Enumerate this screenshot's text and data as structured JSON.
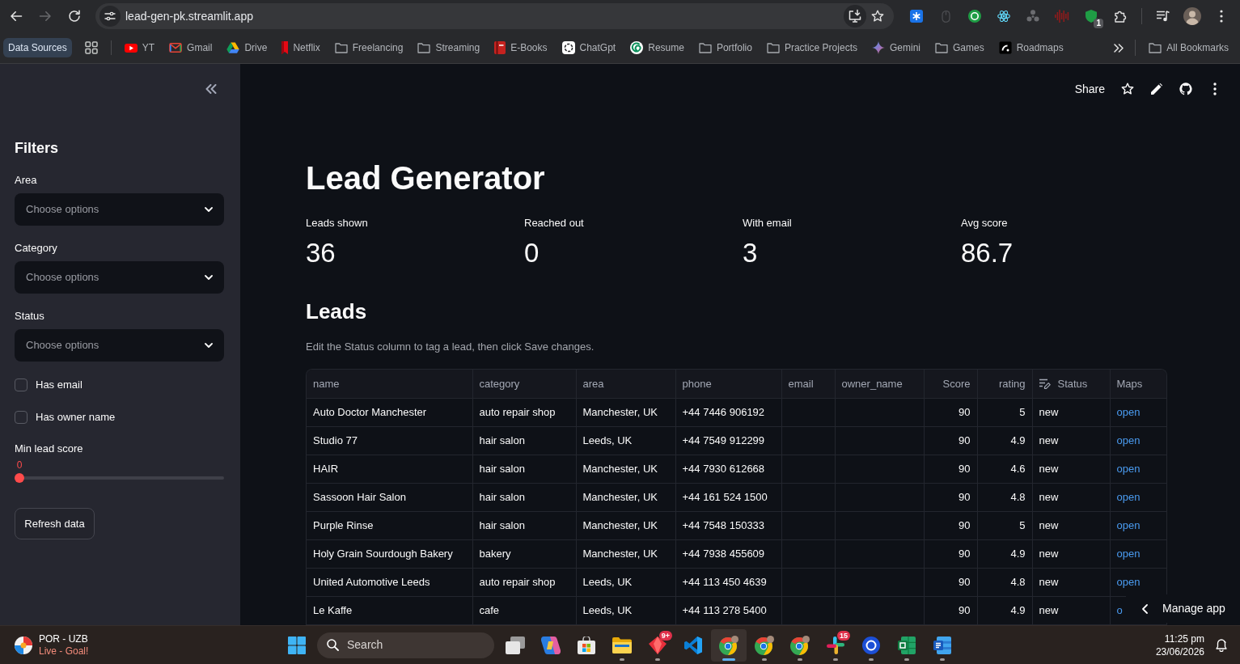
{
  "browser": {
    "nav_buttons": [
      {
        "kind": "back",
        "disabled": false
      },
      {
        "kind": "forward",
        "disabled": true
      },
      {
        "kind": "reload",
        "disabled": false
      }
    ],
    "url": "lead-gen-pk.streamlit.app",
    "extensions": [
      {
        "kind": "tile"
      },
      {
        "kind": "mouse"
      },
      {
        "kind": "disc"
      },
      {
        "kind": "atom"
      },
      {
        "kind": "trefoil"
      },
      {
        "kind": "waveform"
      },
      {
        "kind": "shield",
        "badge": "1"
      },
      {
        "kind": "puzzle"
      }
    ],
    "bookmarks": [
      {
        "kind": "group",
        "label": "Data Sources"
      },
      {
        "kind": "apps"
      },
      {
        "kind": "play",
        "label": "YT"
      },
      {
        "kind": "mail",
        "label": "Gmail"
      },
      {
        "kind": "triangle",
        "label": "Drive"
      },
      {
        "kind": "ribbon",
        "label": "Netflix"
      },
      {
        "kind": "folder",
        "label": "Freelancing"
      },
      {
        "kind": "folder",
        "label": "Streaming"
      },
      {
        "kind": "book",
        "label": "E-Books"
      },
      {
        "kind": "ring",
        "label": "ChatGpt"
      },
      {
        "kind": "swirl",
        "label": "Resume"
      },
      {
        "kind": "folder",
        "label": "Portfolio"
      },
      {
        "kind": "folder",
        "label": "Practice Projects"
      },
      {
        "kind": "sparkle",
        "label": "Gemini"
      },
      {
        "kind": "folder",
        "label": "Games"
      },
      {
        "kind": "tile",
        "label": "Roadmaps"
      }
    ],
    "all_bookmarks": "All Bookmarks"
  },
  "sidebar": {
    "title": "Filters",
    "selects": [
      {
        "label": "Area",
        "placeholder": "Choose options"
      },
      {
        "label": "Category",
        "placeholder": "Choose options"
      },
      {
        "label": "Status",
        "placeholder": "Choose options"
      }
    ],
    "checkboxes": [
      {
        "label": "Has email",
        "checked": false
      },
      {
        "label": "Has owner name",
        "checked": false
      }
    ],
    "slider": {
      "label": "Min lead score",
      "reading": "0",
      "level": 0
    },
    "button": "Refresh data"
  },
  "app_header": {
    "share": "Share"
  },
  "main": {
    "title": "Lead Generator",
    "metrics": [
      {
        "label": "Leads shown",
        "value": "36"
      },
      {
        "label": "Reached out",
        "value": "0"
      },
      {
        "label": "With email",
        "value": "3"
      },
      {
        "label": "Avg score",
        "value": "86.7"
      }
    ],
    "section": "Leads",
    "caption": "Edit the Status column to tag a lead, then click Save changes.",
    "table": {
      "columns": [
        {
          "label": "name",
          "kind": "text"
        },
        {
          "label": "category",
          "kind": "text"
        },
        {
          "label": "area",
          "kind": "text"
        },
        {
          "label": "phone",
          "kind": "text"
        },
        {
          "label": "email",
          "kind": "text"
        },
        {
          "label": "owner_name",
          "kind": "text"
        },
        {
          "label": "Score",
          "kind": "number"
        },
        {
          "label": "rating",
          "kind": "number"
        },
        {
          "label": "Status",
          "kind": "editable"
        },
        {
          "label": "Maps",
          "kind": "link"
        }
      ],
      "rows": [
        {
          "cells": [
            "Auto Doctor Manchester",
            "auto repair shop",
            "Manchester, UK",
            "+44 7446 906192"
          ],
          "end_cells": [
            "90",
            "5",
            "new",
            "open"
          ]
        },
        {
          "cells": [
            "Studio 77",
            "hair salon",
            "Leeds, UK",
            "+44 7549 912299"
          ],
          "end_cells": [
            "90",
            "4.9",
            "new",
            "open"
          ]
        },
        {
          "cells": [
            "HAIR",
            "hair salon",
            "Manchester, UK",
            "+44 7930 612668"
          ],
          "end_cells": [
            "90",
            "4.6",
            "new",
            "open"
          ]
        },
        {
          "cells": [
            "Sassoon Hair Salon",
            "hair salon",
            "Manchester, UK",
            "+44 161 524 1500"
          ],
          "end_cells": [
            "90",
            "4.8",
            "new",
            "open"
          ]
        },
        {
          "cells": [
            "Purple Rinse",
            "hair salon",
            "Manchester, UK",
            "+44 7548 150333"
          ],
          "end_cells": [
            "90",
            "5",
            "new",
            "open"
          ]
        },
        {
          "cells": [
            "Holy Grain Sourdough Bakery",
            "bakery",
            "Manchester, UK",
            "+44 7938 455609"
          ],
          "end_cells": [
            "90",
            "4.9",
            "new",
            "open"
          ]
        },
        {
          "cells": [
            "United Automotive Leeds",
            "auto repair shop",
            "Leeds, UK",
            "+44 113 450 4639"
          ],
          "end_cells": [
            "90",
            "4.8",
            "new",
            "open"
          ]
        },
        {
          "cells": [
            "Le Kaffe",
            "cafe",
            "Leeds, UK",
            "+44 113 278 5400"
          ],
          "end_cells": [
            "90",
            "4.9",
            "new",
            "o"
          ]
        }
      ]
    }
  },
  "manage_app": "Manage app",
  "taskbar": {
    "widget": {
      "title": "POR - UZB",
      "subtitle": "Live - Goal!"
    },
    "search_placeholder": "Search",
    "apps": [
      {
        "kind": "taskview",
        "running": false,
        "selected": false
      },
      {
        "kind": "copilot",
        "running": false,
        "selected": false
      },
      {
        "kind": "store",
        "running": false,
        "selected": false
      },
      {
        "kind": "explorer",
        "running": true,
        "selected": false
      },
      {
        "kind": "gem",
        "running": true,
        "selected": false,
        "badge": "9+"
      },
      {
        "kind": "code",
        "running": false,
        "selected": false
      },
      {
        "kind": "browser",
        "running": true,
        "selected": true
      },
      {
        "kind": "browser",
        "running": true,
        "selected": false
      },
      {
        "kind": "browser",
        "running": true,
        "selected": false
      },
      {
        "kind": "hash",
        "running": true,
        "selected": false,
        "badge": "15"
      },
      {
        "kind": "disc",
        "running": true,
        "selected": false
      },
      {
        "kind": "sheet",
        "running": true,
        "selected": false
      },
      {
        "kind": "doc",
        "running": true,
        "selected": false
      }
    ],
    "time": "11:25 pm",
    "date": "23/06/2026"
  }
}
